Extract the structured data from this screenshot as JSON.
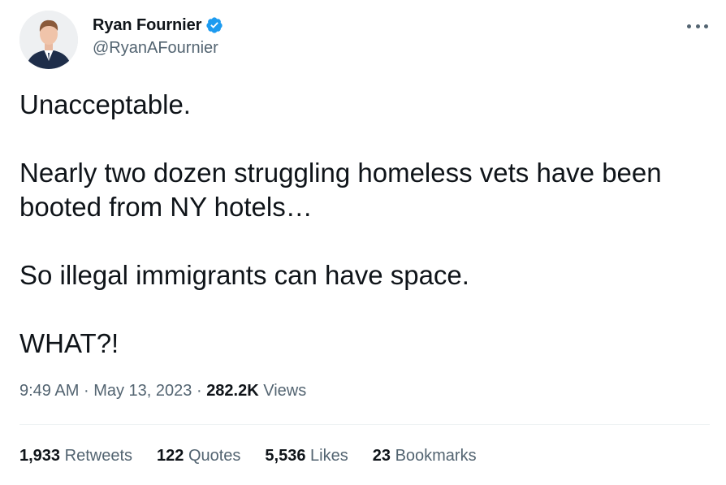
{
  "author": {
    "display_name": "Ryan Fournier",
    "handle": "@RyanAFournier",
    "verified": true,
    "verified_color": "#1d9bf0"
  },
  "tweet": {
    "paragraphs": [
      "Unacceptable.",
      "Nearly two dozen struggling homeless vets have been booted from NY hotels…",
      "So illegal immigrants can have space.",
      "WHAT?!"
    ]
  },
  "meta": {
    "time": "9:49 AM",
    "separator": "·",
    "date": "May 13, 2023",
    "views_count": "282.2K",
    "views_label": "Views"
  },
  "stats": {
    "retweets": {
      "count": "1,933",
      "label": "Retweets"
    },
    "quotes": {
      "count": "122",
      "label": "Quotes"
    },
    "likes": {
      "count": "5,536",
      "label": "Likes"
    },
    "bookmarks": {
      "count": "23",
      "label": "Bookmarks"
    }
  },
  "icons": {
    "more": "more-horizontal-icon",
    "verified": "verified-badge-icon"
  }
}
